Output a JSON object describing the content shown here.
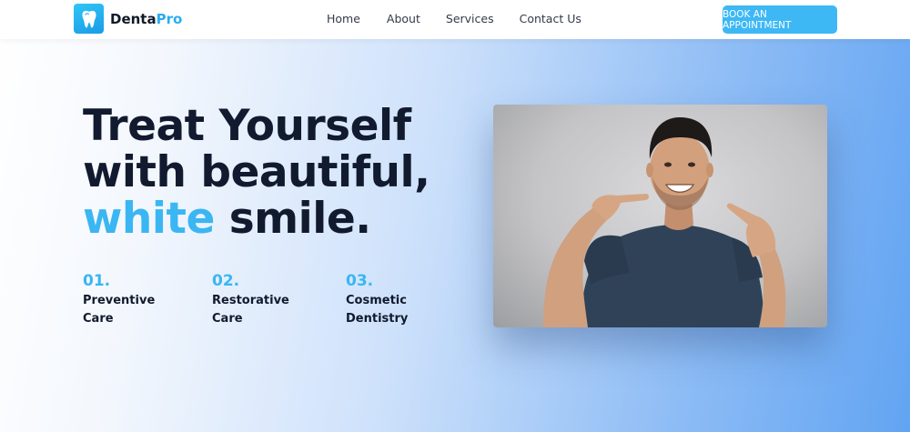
{
  "brand": {
    "name_part1": "Denta",
    "name_part2": "Pro",
    "logo_icon": "tooth-icon"
  },
  "nav": {
    "links": [
      "Home",
      "About",
      "Services",
      "Contact Us"
    ],
    "cta": "BOOK AN APPOINTMENT"
  },
  "hero": {
    "line1": "Treat Yourself",
    "line2": "with beautiful,",
    "line3_accent": "white",
    "line3_rest": " smile.",
    "accent_color": "#3ab6f2"
  },
  "features": [
    {
      "num": "01.",
      "line1": "Preventive",
      "line2": "Care"
    },
    {
      "num": "02.",
      "line1": "Restorative",
      "line2": "Care"
    },
    {
      "num": "03.",
      "line1": "Cosmetic",
      "line2": "Dentistry"
    }
  ],
  "colors": {
    "cta_bg": "#3db8f5",
    "heading": "#111a2e"
  }
}
